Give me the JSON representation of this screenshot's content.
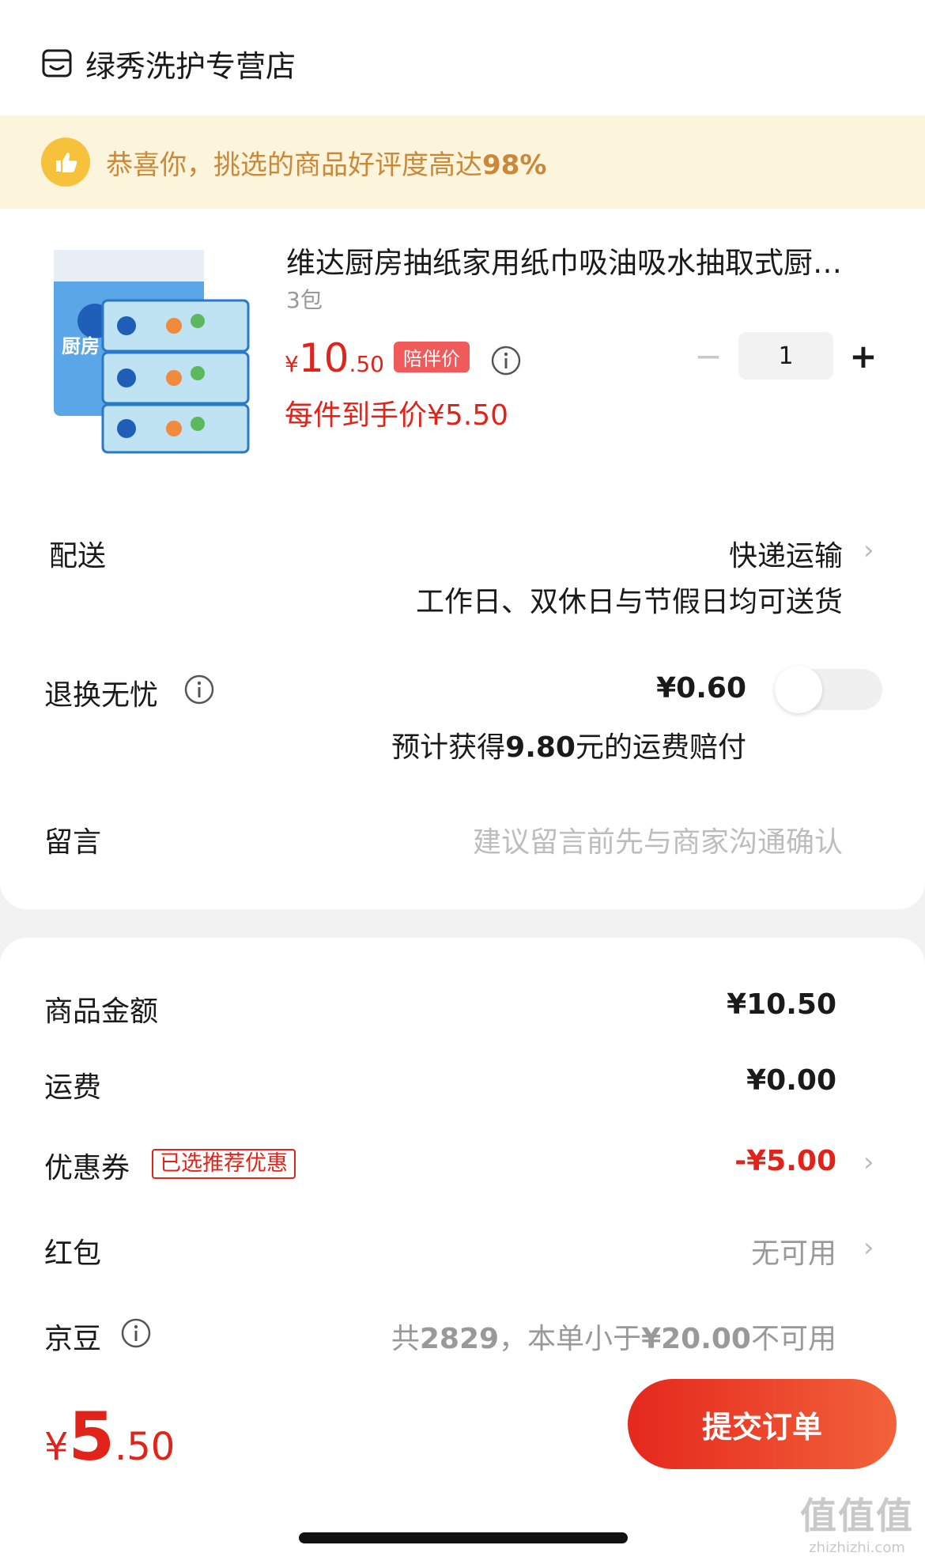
{
  "store": {
    "name": "绿秀洗护专营店",
    "icon": "store-icon"
  },
  "banner": {
    "prefix": "恭喜你，挑选的商品好评度高达",
    "percent": "98%",
    "icon": "thumbs-up-icon"
  },
  "product": {
    "title": "维达厨房抽纸家用纸巾吸油吸水抽取式厨…",
    "spec": "3包",
    "price_symbol": "¥",
    "price_int": "10",
    "price_dec": ".50",
    "price_tag": "陪伴价",
    "hand_price": "每件到手价¥5.50",
    "quantity": "1",
    "minus": "−",
    "plus": "+",
    "image_text": "厨房"
  },
  "delivery": {
    "label": "配送",
    "method": "快递运输",
    "note": "工作日、双休日与节假日均可送货"
  },
  "return": {
    "label": "退换无忧",
    "price": "¥0.60",
    "note_prefix": "预计获得",
    "note_value": "9.80",
    "note_suffix": "元的运费赔付",
    "enabled": false
  },
  "message": {
    "label": "留言",
    "placeholder": "建议留言前先与商家沟通确认"
  },
  "summary": {
    "goods_label": "商品金额",
    "goods_value": "¥10.50",
    "shipping_label": "运费",
    "shipping_value": "¥0.00",
    "coupon_label": "优惠券",
    "coupon_tag": "已选推荐优惠",
    "coupon_value": "-¥5.00",
    "redpacket_label": "红包",
    "redpacket_value": "无可用",
    "bean_label": "京豆",
    "bean_prefix": "共",
    "bean_count": "2829",
    "bean_mid": "，本单小于",
    "bean_threshold": "¥20.00",
    "bean_suffix": "不可用"
  },
  "footer": {
    "total_symbol": "¥",
    "total_int": "5",
    "total_dec": ".50",
    "submit": "提交订单"
  },
  "watermark": {
    "big": "值值值",
    "small": "zhizhizhi.com"
  },
  "colors": {
    "accent": "#e2231a",
    "banner_bg": "#fdf4dc",
    "banner_text": "#c9883a"
  }
}
